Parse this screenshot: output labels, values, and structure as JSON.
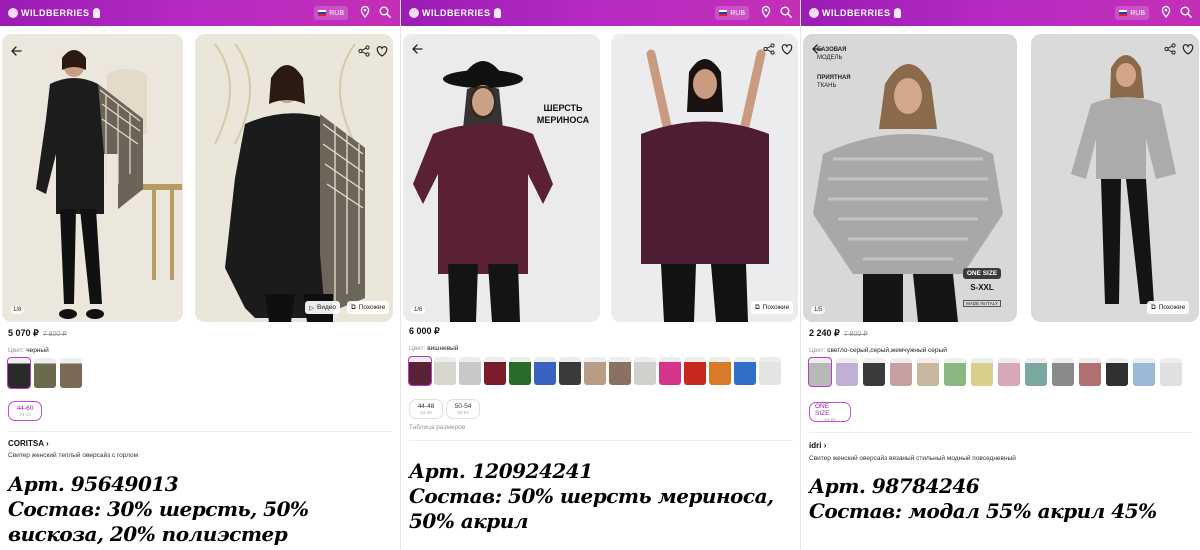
{
  "topbar": {
    "logo": "WILDBERRIES",
    "currency": "RUB"
  },
  "panels": [
    {
      "counter": "1/8",
      "video_label": "Видео",
      "similar_label": "Похожие",
      "price": "5 070 ₽",
      "old_price": "7 800 ₽",
      "color_label": "Цвет:",
      "color_value": "черный",
      "size": {
        "size": "44-60",
        "ru": "44-14"
      },
      "brand": "CORITSA",
      "description": "Свитер женский теплый оверсайз с горлом",
      "article": "Арт. 95649013",
      "composition": "Состав: 30% шерсть, 50% вискоза, 20% полиэстер"
    },
    {
      "counter": "1/6",
      "similar_label": "Похожие",
      "overlay": "ШЕРСТЬ МЕРИНОСА",
      "price": "6 000 ₽",
      "color_label": "Цвет:",
      "color_value": "вишневый",
      "sizes": [
        {
          "size": "44-48",
          "ru": "44-48"
        },
        {
          "size": "50-54",
          "ru": "50-54"
        }
      ],
      "size_table": "Таблица размеров",
      "article": "Арт. 120924241",
      "composition": "Состав: 50% шерсть мериноса, 50% акрил"
    },
    {
      "counter": "1/5",
      "similar_label": "Похожие",
      "badge1": "БАЗОВАЯ",
      "badge1_sub": "МОДЕЛЬ",
      "badge2": "ПРИЯТНАЯ",
      "badge2_sub": "ТКАНЬ",
      "onesize": "ONE SIZE",
      "onesize_range": "S-XXL",
      "made": "MADE IN ITALY",
      "price": "2 240 ₽",
      "old_price": "7 800 ₽",
      "color_label": "Цвет:",
      "color_value": "светло-серый,серый,жемчужный серый",
      "size": {
        "size": "ONE SIZE",
        "ru": "44-56"
      },
      "brand": "idri",
      "description": "Свитер женский оверсайз вязаный стильный модный повседневный",
      "article": "Арт. 98784246",
      "composition": "Состав: модал 55% акрил 45%"
    }
  ],
  "swatches_p1": [
    "#2a2a2a",
    "#6b6a4a",
    "#7a6a55"
  ],
  "swatches_p2": [
    "#5a2238",
    "#d9d5cf",
    "#c8c8c8",
    "#7a1c2a",
    "#2a6a2a",
    "#3a62c0",
    "#3a3a3a",
    "#b89c86",
    "#8a7060",
    "#d0d0cc",
    "#d6348a",
    "#c8281e",
    "#d77a2a",
    "#2f6fc8",
    "#e4e4e4"
  ],
  "swatches_p3": [
    "#b8b8b8",
    "#c0b0d6",
    "#3a3a3a",
    "#c8a0a0",
    "#c8b8a0",
    "#8ab880",
    "#d8d08a",
    "#d8a8b8",
    "#7aa8a0",
    "#8a8a8a",
    "#b07070",
    "#303030",
    "#9ab8d8",
    "#e0e0e0"
  ]
}
